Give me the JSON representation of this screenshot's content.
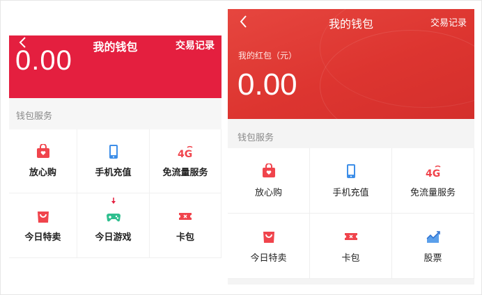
{
  "left": {
    "title": "我的钱包",
    "record": "交易记录",
    "amount": "0.00",
    "section": "钱包服务",
    "services": [
      {
        "label": "放心购",
        "icon": "gift-bag-icon"
      },
      {
        "label": "手机充值",
        "icon": "phone-icon"
      },
      {
        "label": "免流量服务",
        "icon": "4g-icon"
      },
      {
        "label": "今日特卖",
        "icon": "shopping-bag-icon"
      },
      {
        "label": "今日游戏",
        "icon": "gamepad-icon"
      },
      {
        "label": "卡包",
        "icon": "ticket-icon"
      }
    ]
  },
  "right": {
    "title": "我的钱包",
    "record": "交易记录",
    "sublabel": "我的红包（元）",
    "amount": "0.00",
    "section": "钱包服务",
    "services": [
      {
        "label": "放心购",
        "icon": "gift-bag-icon"
      },
      {
        "label": "手机充值",
        "icon": "phone-icon"
      },
      {
        "label": "免流量服务",
        "icon": "4g-icon"
      },
      {
        "label": "今日特卖",
        "icon": "shopping-bag-icon"
      },
      {
        "label": "卡包",
        "icon": "ticket-icon"
      },
      {
        "label": "股票",
        "icon": "stock-chart-icon"
      }
    ]
  },
  "colors": {
    "left_header": "#e41f3f",
    "right_header": "#dd3530",
    "icon_red": "#f0444c",
    "icon_blue": "#3d8ee8",
    "icon_green": "#2fbf8f"
  }
}
